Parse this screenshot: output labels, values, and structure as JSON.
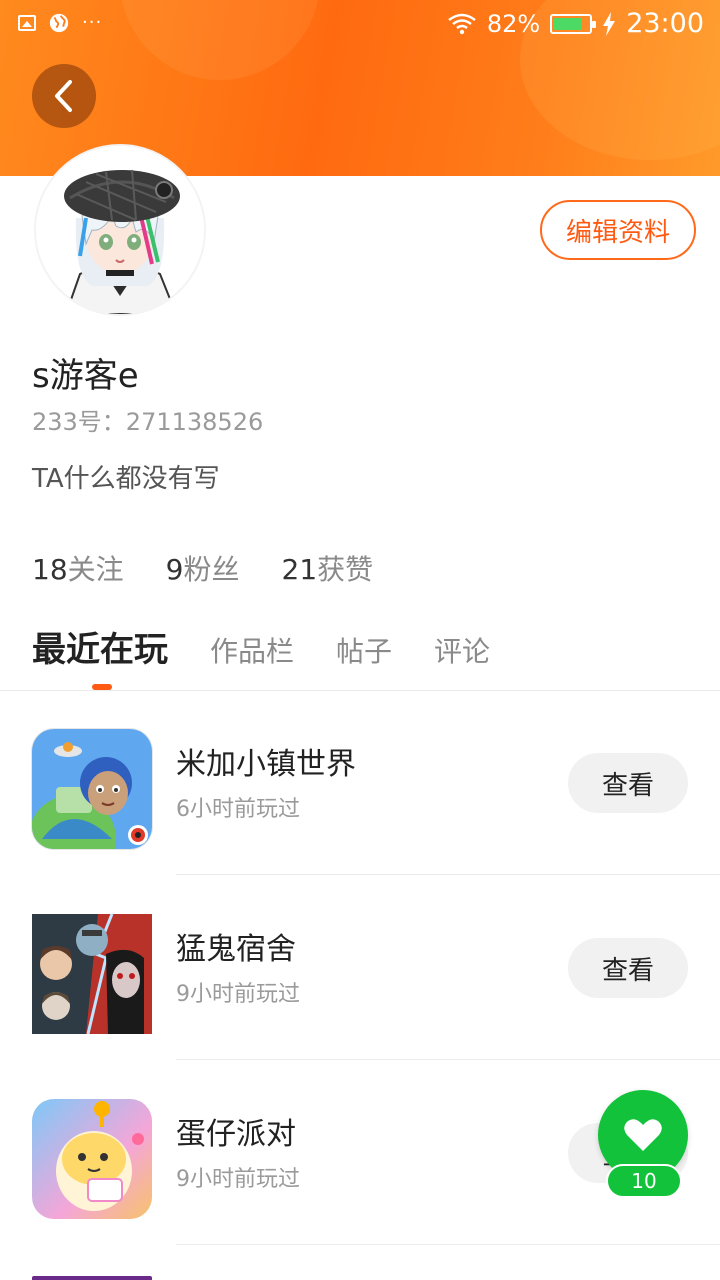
{
  "status_bar": {
    "battery_pct": "82%",
    "battery_level": 0.82,
    "battery_color": "#4cd964",
    "time": "23:00",
    "overflow": "···"
  },
  "header": {
    "accent": "#ff6a10",
    "back_icon": "chevron-left-icon"
  },
  "profile": {
    "edit_label": "编辑资料",
    "username": "s游客e",
    "user_id": "233号：271138526",
    "bio": "TA什么都没有写"
  },
  "stats": {
    "following_num": "18",
    "following_label": "关注",
    "fans_num": "9",
    "fans_label": "粉丝",
    "likes_num": "21",
    "likes_label": "获赞"
  },
  "tabs": [
    {
      "label": "最近在玩",
      "active": true
    },
    {
      "label": "作品栏",
      "active": false
    },
    {
      "label": "帖子",
      "active": false
    },
    {
      "label": "评论",
      "active": false
    }
  ],
  "games": [
    {
      "name": "米加小镇世界",
      "played": "6小时前玩过",
      "button": "查看"
    },
    {
      "name": "猛鬼宿舍",
      "played": "9小时前玩过",
      "button": "查看"
    },
    {
      "name": "蛋仔派对",
      "played": "9小时前玩过",
      "button": "查看"
    }
  ],
  "fab": {
    "icon": "heart-icon",
    "count": "10",
    "color": "#12c23a"
  }
}
